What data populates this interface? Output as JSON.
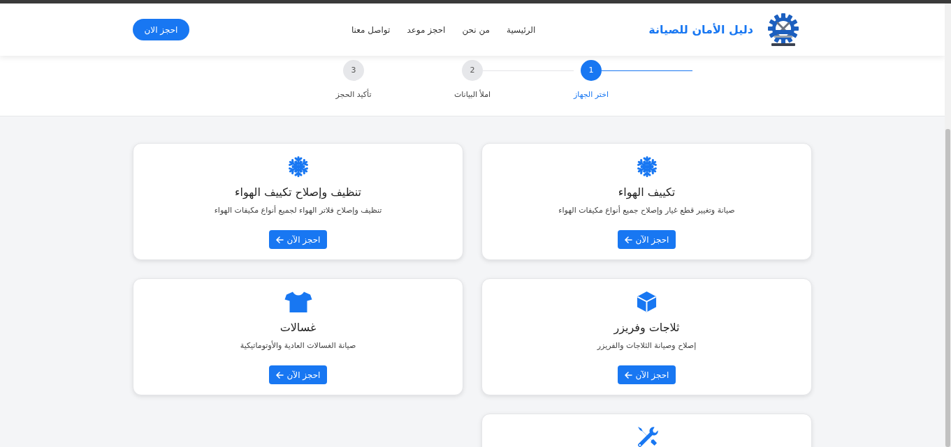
{
  "header": {
    "brand": "دليل الأمان للصيانة",
    "nav": [
      "الرئيسية",
      "من نحن",
      "احجز موعد",
      "تواصل معنا"
    ],
    "cta": "احجز الان"
  },
  "steps": [
    {
      "number": "1",
      "label": "اختر الجهاز",
      "selected": true
    },
    {
      "number": "2",
      "label": "املأ البيانات",
      "selected": false
    },
    {
      "number": "3",
      "label": "تأكيد الحجز",
      "selected": false
    }
  ],
  "services": [
    {
      "kind": "snowflake",
      "title": "تكييف الهواء",
      "description": "صيانة وتغيير قطع غيار وإصلاح جميع أنواع مكيفات الهواء",
      "button": "احجز الآن"
    },
    {
      "kind": "snowflake",
      "title": "تنظيف وإصلاح تكييف الهواء",
      "description": "تنظيف وإصلاح فلاتر الهواء لجميع أنواع مكيفات الهواء",
      "button": "احجز الآن"
    },
    {
      "kind": "box",
      "title": "ثلاجات وفريزر",
      "description": "إصلاح وصيانة الثلاجات والفريزر",
      "button": "احجز الآن"
    },
    {
      "kind": "shirt",
      "title": "غسالات",
      "description": "صيانة الغسالات العادية والأوتوماتيكية",
      "button": "احجز الآن"
    },
    {
      "kind": "tools"
    }
  ]
}
